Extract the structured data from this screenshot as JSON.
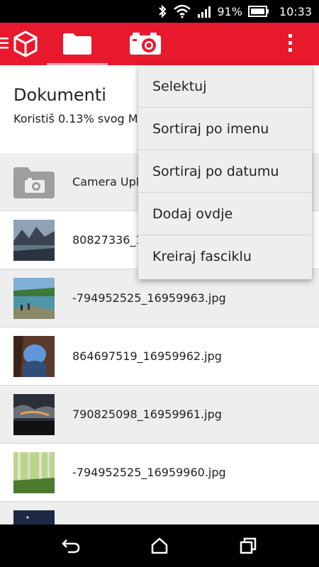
{
  "status_bar": {
    "battery_percent": "91%",
    "time": "10:33"
  },
  "header": {
    "title": "Dokumenti",
    "subtitle": "Koristiš 0.13% svog M"
  },
  "files": [
    {
      "name": "Camera Uplo",
      "type": "folder"
    },
    {
      "name": "80827336_1",
      "type": "image",
      "thumb": "mountain-lake"
    },
    {
      "name": "-794952525_16959963.jpg",
      "type": "image",
      "thumb": "lake-shore"
    },
    {
      "name": "864697519_16959962.jpg",
      "type": "image",
      "thumb": "rock-arch"
    },
    {
      "name": "790825098_16959961.jpg",
      "type": "image",
      "thumb": "cloudy-sky"
    },
    {
      "name": "-794952525_16959960.jpg",
      "type": "image",
      "thumb": "forest"
    },
    {
      "name": "",
      "type": "image",
      "thumb": "night-sky"
    }
  ],
  "menu": {
    "items": [
      "Selektuj",
      "Sortiraj po imenu",
      "Sortiraj po datumu",
      "Dodaj ovdje",
      "Kreiraj fasciklu"
    ]
  },
  "colors": {
    "accent": "#e8192c",
    "row_shade": "#eeeeee",
    "menu_bg": "#eeeeee"
  }
}
